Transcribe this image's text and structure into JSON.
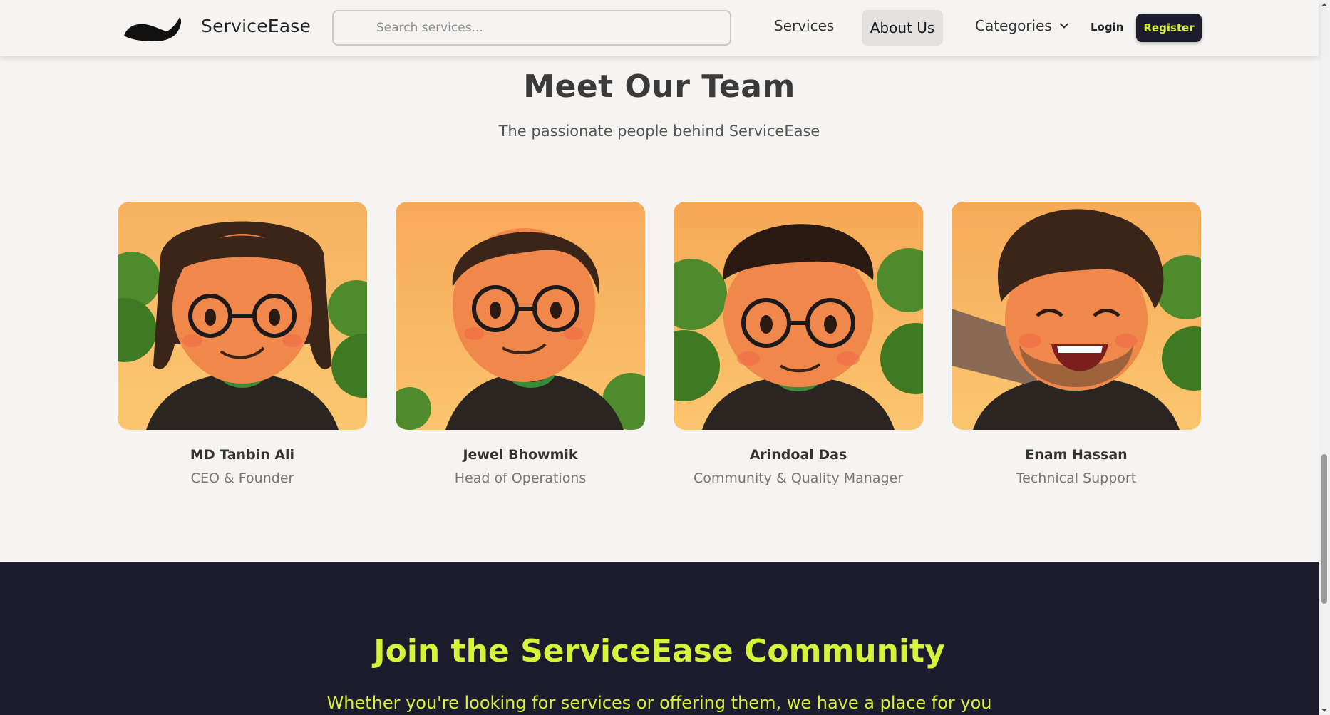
{
  "nav": {
    "brand": "ServiceEase",
    "search_placeholder": "Search services...",
    "links": {
      "services": "Services",
      "about": "About Us",
      "categories": "Categories"
    },
    "login": "Login",
    "register": "Register"
  },
  "team": {
    "title": "Meet Our Team",
    "subtitle": "The passionate people behind ServiceEase",
    "members": [
      {
        "name": "MD Tanbin Ali",
        "role": "CEO & Founder"
      },
      {
        "name": "Jewel Bhowmik",
        "role": "Head of Operations"
      },
      {
        "name": "Arindoal Das",
        "role": "Community & Quality Manager"
      },
      {
        "name": "Enam Hassan",
        "role": "Technical Support"
      }
    ]
  },
  "community": {
    "title": "Join the ServiceEase Community",
    "text": "Whether you're looking for services or offering them, we have a place for you"
  },
  "colors": {
    "accent": "#d6f23a",
    "dark": "#1d1c2c",
    "background": "#f6f4f2"
  }
}
